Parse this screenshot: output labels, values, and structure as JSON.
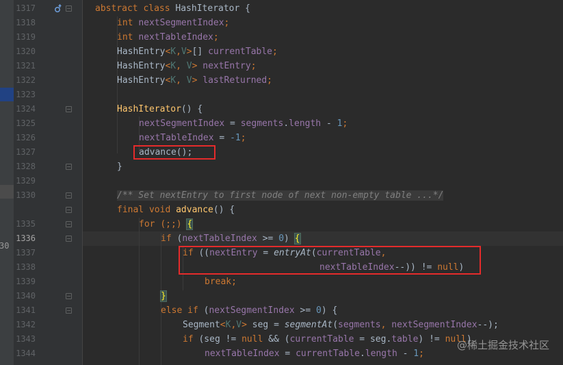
{
  "editor": {
    "left_gutter_fragment": "30",
    "watermark": "@稀土掘金技术社区"
  },
  "line_numbers": [
    "1317",
    "1318",
    "1319",
    "1320",
    "1321",
    "1322",
    "1323",
    "1324",
    "1325",
    "1326",
    "1327",
    "1328",
    "1329",
    "1330",
    "1335",
    "1336",
    "1337",
    "1338",
    "1339",
    "1340",
    "1341",
    "1342",
    "1343",
    "1344"
  ],
  "current_line_number": "1336",
  "code": {
    "l1317": {
      "kw": "abstract class ",
      "name": "HashIterator",
      "rest": " {"
    },
    "l1318": {
      "kw": "int ",
      "name": "nextSegmentIndex",
      "rest": ";"
    },
    "l1319": {
      "kw": "int ",
      "name": "nextTableIndex",
      "rest": ";"
    },
    "l1320": {
      "type": "HashEntry",
      "gen_open": "<",
      "g1": "K",
      "sep": ",",
      "g2": "V",
      "gen_close": ">",
      "arr": "[] ",
      "name": "currentTable",
      "rest": ";"
    },
    "l1321": {
      "type": "HashEntry",
      "gen_open": "<",
      "g1": "K",
      "sep": ", ",
      "g2": "V",
      "gen_close": "> ",
      "name": "nextEntry",
      "rest": ";"
    },
    "l1322": {
      "type": "HashEntry",
      "gen_open": "<",
      "g1": "K",
      "sep": ", ",
      "g2": "V",
      "gen_close": "> ",
      "name": "lastReturned",
      "rest": ";"
    },
    "l1324": {
      "name": "HashIterator",
      "rest": "() {"
    },
    "l1325": {
      "f1": "nextSegmentIndex",
      "op": " = ",
      "f2": "segments",
      "dot": ".",
      "f3": "length",
      "op2": " - ",
      "num": "1",
      "end": ";"
    },
    "l1326": {
      "f1": "nextTableIndex",
      "op": " = ",
      "num": "-1",
      "end": ";"
    },
    "l1327": {
      "text": "advance();"
    },
    "l1328": {
      "text": "}"
    },
    "l1330": {
      "comment": "/** Set nextEntry to first node of next non-empty table ...*/"
    },
    "l1331": {
      "kw": "final void ",
      "name": "advance",
      "rest": "() {"
    },
    "l1335": {
      "kw": "for ",
      "mid": "(;;) ",
      "brace": "{"
    },
    "l1336": {
      "kw": "if ",
      "p1": "(",
      "f1": "nextTableIndex",
      "op": " >= ",
      "num": "0",
      "p2": ") ",
      "brace": "{"
    },
    "l1337": {
      "kw": "if ",
      "p1": "((",
      "f1": "nextEntry",
      "op": " = ",
      "call": "entryAt",
      "p2": "(",
      "f2": "currentTable",
      "end": ","
    },
    "l1338": {
      "f1": "nextTableIndex",
      "op": "--)) != ",
      "kw": "null",
      "end": ")"
    },
    "l1339": {
      "kw": "break",
      "end": ";"
    },
    "l1340": {
      "brace": "}"
    },
    "l1341": {
      "kw": "else if ",
      "p1": "(",
      "f1": "nextSegmentIndex",
      "op": " >= ",
      "num": "0",
      "p2": ") {"
    },
    "l1342": {
      "type": "Segment",
      "gen_open": "<",
      "g1": "K",
      "sep": ",",
      "g2": "V",
      "gen_close": "> ",
      "var": "seg = ",
      "call": "segmentAt",
      "p1": "(",
      "f1": "segments",
      "sep2": ", ",
      "f2": "nextSegmentIndex",
      "end": "--);"
    },
    "l1343": {
      "kw": "if ",
      "p1": "(seg != ",
      "kw2": "null",
      "and": " && (",
      "f1": "currentTable",
      "op": " = seg.",
      "f2": "table",
      "end": ") != ",
      "kw3": "null",
      "close": ")"
    },
    "l1344": {
      "f1": "nextTableIndex",
      "op": " = ",
      "f2": "currentTable",
      "dot": ".",
      "f3": "length",
      "op2": " - ",
      "num": "1",
      "end": ";"
    }
  }
}
